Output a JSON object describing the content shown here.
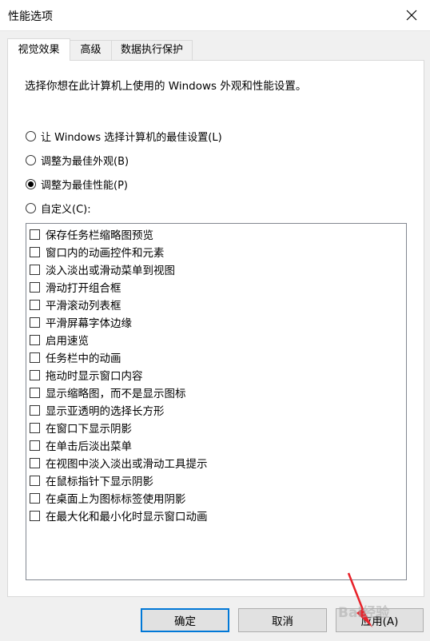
{
  "window": {
    "title": "性能选项",
    "close_icon": "close-icon"
  },
  "tabs": [
    {
      "label": "视觉效果",
      "active": true
    },
    {
      "label": "高级",
      "active": false
    },
    {
      "label": "数据执行保护",
      "active": false
    }
  ],
  "description": "选择你想在此计算机上使用的 Windows 外观和性能设置。",
  "radios": [
    {
      "label": "让 Windows 选择计算机的最佳设置(L)",
      "checked": false
    },
    {
      "label": "调整为最佳外观(B)",
      "checked": false
    },
    {
      "label": "调整为最佳性能(P)",
      "checked": true
    },
    {
      "label": "自定义(C):",
      "checked": false
    }
  ],
  "options": [
    "保存任务栏缩略图预览",
    "窗口内的动画控件和元素",
    "淡入淡出或滑动菜单到视图",
    "滑动打开组合框",
    "平滑滚动列表框",
    "平滑屏幕字体边缘",
    "启用速览",
    "任务栏中的动画",
    "拖动时显示窗口内容",
    "显示缩略图，而不是显示图标",
    "显示亚透明的选择长方形",
    "在窗口下显示阴影",
    "在单击后淡出菜单",
    "在视图中淡入淡出或滑动工具提示",
    "在鼠标指针下显示阴影",
    "在桌面上为图标标签使用阴影",
    "在最大化和最小化时显示窗口动画"
  ],
  "buttons": {
    "ok": "确定",
    "cancel": "取消",
    "apply": "应用(A)"
  },
  "watermark": "Bai经验",
  "colors": {
    "default_button_border": "#0078d7",
    "arrow": "#e8222a"
  }
}
